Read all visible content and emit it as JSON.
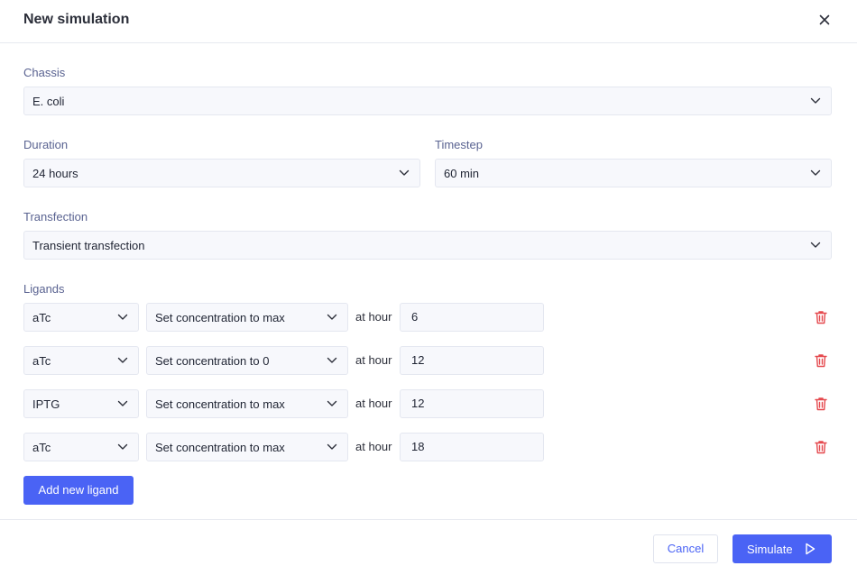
{
  "dialog": {
    "title": "New simulation",
    "close_icon": "close-icon"
  },
  "chassis": {
    "label": "Chassis",
    "value": "E. coli"
  },
  "duration": {
    "label": "Duration",
    "value": "24 hours"
  },
  "timestep": {
    "label": "Timestep",
    "value": "60 min"
  },
  "transfection": {
    "label": "Transfection",
    "value": "Transient transfection"
  },
  "ligands": {
    "label": "Ligands",
    "rows": [
      {
        "ligand": "aTc",
        "action": "Set concentration to max",
        "at_label": "at hour",
        "hour": "6"
      },
      {
        "ligand": "aTc",
        "action": "Set concentration to 0",
        "at_label": "at hour",
        "hour": "12"
      },
      {
        "ligand": "IPTG",
        "action": "Set concentration to max",
        "at_label": "at hour",
        "hour": "12"
      },
      {
        "ligand": "aTc",
        "action": "Set concentration to max",
        "at_label": "at hour",
        "hour": "18"
      }
    ],
    "add_label": "Add new ligand"
  },
  "footer": {
    "cancel_label": "Cancel",
    "simulate_label": "Simulate"
  },
  "colors": {
    "accent": "#4a63f5",
    "delete": "#e5484d",
    "field_bg": "#f7f8fc",
    "label": "#5a6391"
  }
}
